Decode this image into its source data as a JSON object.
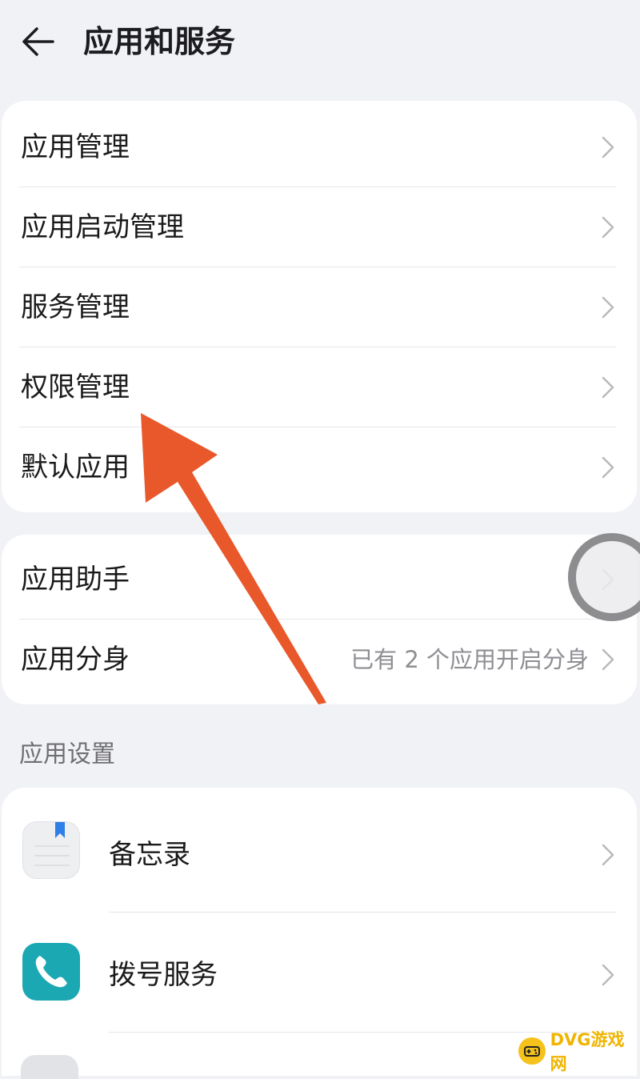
{
  "header": {
    "title": "应用和服务",
    "back_icon": "back-arrow-icon"
  },
  "group1": {
    "items": [
      {
        "label": "应用管理"
      },
      {
        "label": "应用启动管理"
      },
      {
        "label": "服务管理"
      },
      {
        "label": "权限管理"
      },
      {
        "label": "默认应用"
      }
    ]
  },
  "group2": {
    "items": [
      {
        "label": "应用助手",
        "value": ""
      },
      {
        "label": "应用分身",
        "value": "已有 2 个应用开启分身"
      }
    ]
  },
  "app_settings": {
    "title": "应用设置",
    "apps": [
      {
        "label": "备忘录",
        "icon": "notepad-icon"
      },
      {
        "label": "拨号服务",
        "icon": "phone-icon"
      }
    ]
  },
  "watermark": {
    "text": "DVG游戏网"
  },
  "colors": {
    "background": "#f1f2f6",
    "card": "#ffffff",
    "arrow": "#e8582a",
    "phone_icon": "#1ba8b3",
    "watermark": "#f0b400"
  }
}
